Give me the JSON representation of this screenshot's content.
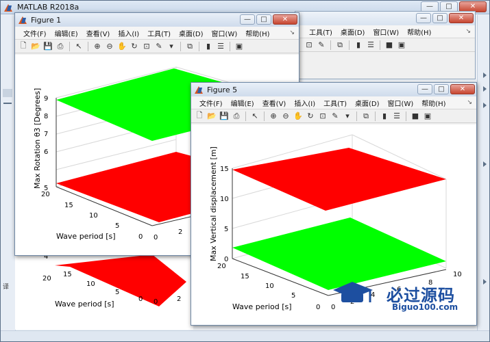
{
  "app": {
    "title": "MATLAB R2018a"
  },
  "window_controls": {
    "minimize": "—",
    "restore": "□",
    "close": "✕"
  },
  "menu": [
    "文件(F)",
    "编辑(E)",
    "查看(V)",
    "插入(I)",
    "工具(T)",
    "桌面(D)",
    "窗口(W)",
    "帮助(H)"
  ],
  "menu_arrow": "↘",
  "background_window": {
    "menu_tail": [
      "工具(T)",
      "桌面(D)",
      "窗口(W)",
      "帮助(H)"
    ],
    "left_glyph": "译"
  },
  "toolbar_icons": [
    "new-file-icon",
    "open-icon",
    "save-icon",
    "print-icon",
    "pointer-icon",
    "zoom-in-icon",
    "zoom-out-icon",
    "pan-icon",
    "rotate-icon",
    "data-cursor-icon",
    "brush-icon",
    "link-icon",
    "colorbar-icon",
    "legend-icon",
    "hide-tools-icon",
    "plot-tools-icon"
  ],
  "figures": [
    {
      "id": "figure1",
      "title": "Figure 1",
      "ylabel": "Max Rotation θ3 [Degrees]",
      "xlabel": "Wave period [s]",
      "zticks": [
        "5",
        "6",
        "7",
        "8",
        "9"
      ],
      "xticks": [
        "20",
        "15",
        "10",
        "5",
        "0"
      ],
      "yticks": [
        "0",
        "2"
      ],
      "surfaces": [
        {
          "color": "#00ff00",
          "value": 9
        },
        {
          "color": "#ff0000",
          "value": 5
        }
      ]
    },
    {
      "id": "figure5",
      "title": "Figure 5",
      "ylabel": "Max Vertical displacement [m]",
      "xlabel": "Wave period [s]",
      "zticks": [
        "0",
        "5",
        "10",
        "15"
      ],
      "xticks": [
        "20",
        "15",
        "10",
        "5",
        "0"
      ],
      "yticks": [
        "0",
        "2",
        "4",
        "6",
        "8",
        "10"
      ],
      "surfaces": [
        {
          "color": "#ff0000",
          "value": 15
        },
        {
          "color": "#00ff00",
          "value": 1.5
        }
      ]
    }
  ],
  "hidden_figure": {
    "ztick": "4",
    "xlabel": "Wave period [s]",
    "xticks": [
      "20",
      "15",
      "10",
      "5",
      "0"
    ],
    "yticks": [
      "0",
      "2"
    ]
  },
  "watermark": {
    "title": "必过源码",
    "url": "Biguo100.com"
  }
}
